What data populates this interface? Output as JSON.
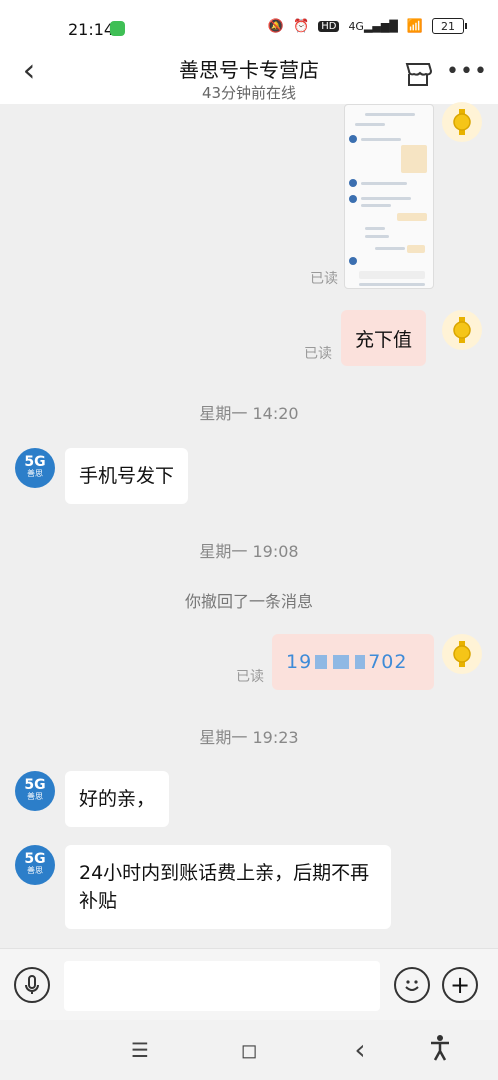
{
  "status": {
    "time": "21:14",
    "network": "4G",
    "hd": "HD",
    "battery": "21"
  },
  "header": {
    "title": "善思号卡专营店",
    "subtitle": "43分钟前在线"
  },
  "messages": {
    "read_label": "已读",
    "msg_recharge": "充下值",
    "time_1": "星期一 14:20",
    "msg_phone_request": "手机号发下",
    "time_2": "星期一 19:08",
    "recall_notice": "你撤回了一条消息",
    "phone_prefix": "19",
    "phone_suffix": "702",
    "time_3": "星期一 19:23",
    "msg_ok": "好的亲，",
    "msg_arrival": "24小时内到账话费上亲，后期不再补贴"
  },
  "avatar": {
    "shop_badge": "5G",
    "shop_sub": "善思"
  },
  "colors": {
    "my_bubble": "#fbe1dc",
    "shop_avatar": "#2c7ec9",
    "background": "#efefef"
  },
  "nav": {
    "menu": "☰",
    "home": "◻",
    "back": "‹"
  }
}
